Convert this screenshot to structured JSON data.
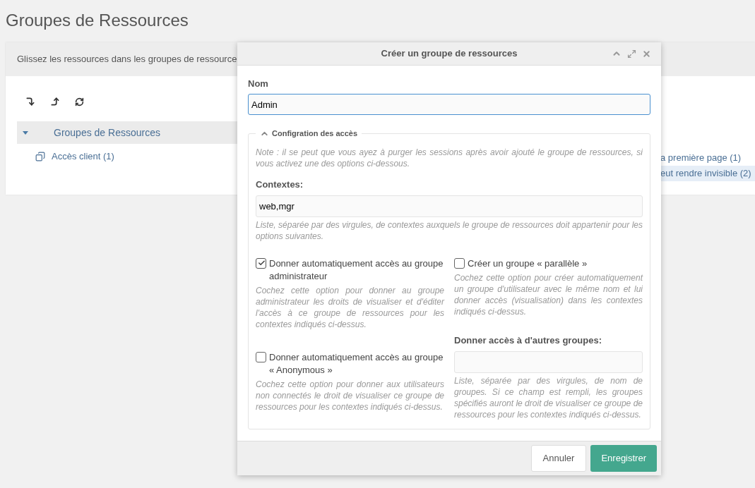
{
  "page_title": "Groupes de Ressources",
  "panel": {
    "description": "Glissez les ressources dans les groupes de ressource",
    "tree": {
      "label": "Groupes de Ressources",
      "expanded": true,
      "children": [
        {
          "label": "Accès client (1)"
        }
      ]
    },
    "right_items": [
      {
        "label": "a première page (1)",
        "selected": false
      },
      {
        "label": "eut rendre invisible (2)",
        "selected": true
      }
    ]
  },
  "dialog": {
    "title": "Créer un groupe de ressources",
    "name_field": {
      "label": "Nom",
      "value": "Admin"
    },
    "fieldset": {
      "legend": "Configration des accès",
      "expanded": true,
      "note": "Note : il se peut que vous ayez à purger les sessions après avoir ajouté le groupe de ressources, si vous activez une des options ci-dessous.",
      "contexts": {
        "label": "Contextes:",
        "value": "web,mgr",
        "help": "Liste, séparée par des virgules, de contextes auxquels le groupe de ressources doit appartenir pour les options suivantes."
      },
      "left_column": [
        {
          "kind": "checkbox",
          "label": "Donner automatiquement accès au groupe administrateur",
          "checked": true,
          "help": "Cochez cette option pour donner au groupe administrateur les droits de visualiser et d'éditer l'accès à ce groupe de ressources pour les contextes indiqués ci-dessus."
        },
        {
          "kind": "checkbox",
          "label": "Donner automatiquement accès au groupe « Anonymous »",
          "checked": false,
          "help": "Cochez cette option pour donner aux utilisateurs non connectés le droit de visualiser ce groupe de ressources pour les contextes indiqués ci-dessus."
        }
      ],
      "right_column": [
        {
          "kind": "checkbox",
          "label": "Créer un groupe « parallèle »",
          "checked": false,
          "help": "Cochez cette option pour créer automatiquement un groupe d'utilisateur avec le même nom et lui donner accès (visualisation) dans les contextes indiqués ci-dessus."
        },
        {
          "kind": "field",
          "label": "Donner accès à d'autres groupes:",
          "help": "Liste, séparée par des virgules, de nom de groupes. Si ce champ est rempli, les groupes spécifiés auront le droit de visualiser ce groupe de ressources pour les contextes indiqués ci-dessus."
        }
      ]
    },
    "buttons": [
      {
        "label": "Annuler",
        "kind": "secondary"
      },
      {
        "label": "Enregistrer",
        "kind": "primary"
      }
    ]
  }
}
